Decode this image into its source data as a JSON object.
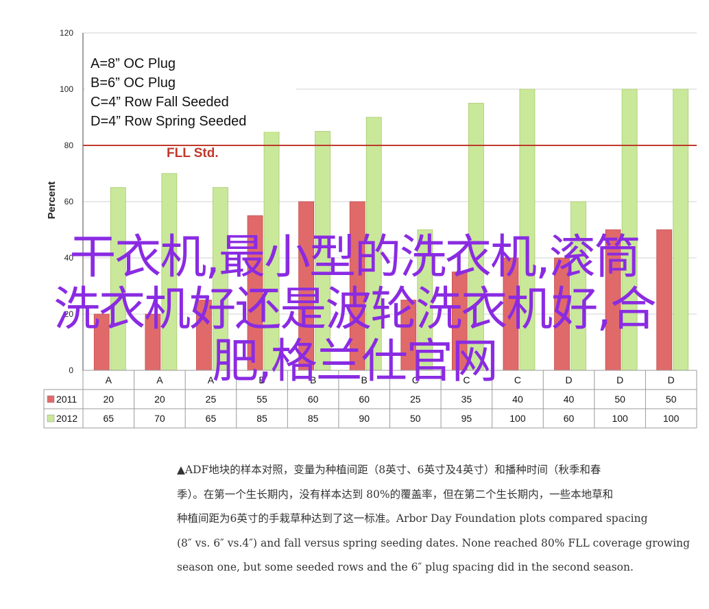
{
  "chart_data": {
    "type": "bar",
    "categories": [
      "A",
      "A",
      "A",
      "B",
      "B",
      "B",
      "C",
      "C",
      "C",
      "D",
      "D",
      "D"
    ],
    "series": [
      {
        "name": "2011",
        "values": [
          20,
          20,
          25,
          55,
          60,
          60,
          25,
          35,
          40,
          40,
          50,
          50
        ],
        "color": "#e06a6a"
      },
      {
        "name": "2012",
        "values": [
          65,
          70,
          65,
          85,
          85,
          90,
          50,
          95,
          100,
          60,
          100,
          100
        ],
        "color": "#c9e89a"
      }
    ],
    "title": "",
    "xlabel": "",
    "ylabel": "Percent",
    "ylim": [
      0,
      120
    ],
    "yticks": [
      "0",
      "20",
      "40",
      "60",
      "80",
      "100",
      "120"
    ],
    "legend_lines": [
      "A=8” OC Plug",
      "B=6” OC Plug",
      "C=4” Row Fall Seeded",
      "D=4” Row Spring Seeded"
    ],
    "reference_line": {
      "label": "FLL Std.",
      "value": 80,
      "color": "#c0392b"
    },
    "data_table": true,
    "grid": "horizontal"
  },
  "overlay_text": [
    "干衣机,最小型的洗衣机,滚筒",
    "洗衣机好还是波轮洗衣机好,合",
    "肥,格兰仕官网"
  ],
  "caption_lines": [
    "▲ADF地块的样本对照，变量为种植间距（8英寸、6英寸及4英寸）和播种时间（秋季和春",
    "季）。在第一个生长期内，没有样本达到 80%的覆盖率，但在第二个生长期内，一些本地草和",
    "种植间距为6英寸的手栽草种达到了这一标准。Arbor Day Foundation plots compared spacing",
    "(8″ vs. 6″ vs.4″) and fall versus spring seeding dates. None reached 80% FLL coverage growing",
    "season one, but some seeded rows and the 6″ plug spacing did in the second season."
  ],
  "colors": {
    "overlay": "#8a2be2",
    "grid": "#d0d0d0",
    "axis": "#444444"
  }
}
